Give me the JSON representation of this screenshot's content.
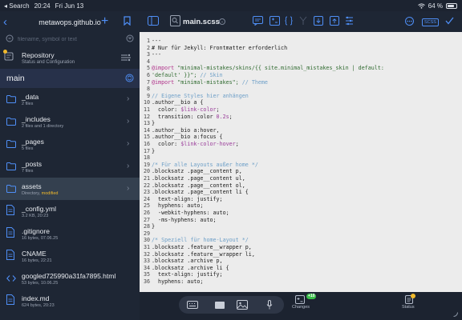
{
  "status_bar": {
    "back_app": "Search",
    "time": "20:24",
    "date": "Fri Jun 13",
    "battery": "64 %",
    "battery_level": 0.64
  },
  "sidebar": {
    "title": "metawops.github.io",
    "search_placeholder": "filename, symbol or text",
    "repository": {
      "name": "Repository",
      "subtitle": "Status and Configuration"
    },
    "branch": "main",
    "files": [
      {
        "name": "_data",
        "meta": "2 files",
        "type": "folder",
        "modified": "",
        "chevron": true
      },
      {
        "name": "_includes",
        "meta": "2 files and 1 directory",
        "type": "folder",
        "modified": "",
        "chevron": true
      },
      {
        "name": "_pages",
        "meta": "5 files",
        "type": "folder",
        "modified": "",
        "chevron": true
      },
      {
        "name": "_posts",
        "meta": "7 files",
        "type": "folder",
        "modified": "",
        "chevron": true
      },
      {
        "name": "assets",
        "meta": "Directory, ",
        "type": "folder",
        "modified": "modified",
        "chevron": true
      },
      {
        "name": "_config.yml",
        "meta": "3.2 KB, 20:23",
        "type": "file",
        "modified": "",
        "chevron": false
      },
      {
        "name": ".gitignore",
        "meta": "16 bytes, 07.06.25",
        "type": "file",
        "modified": "",
        "chevron": false
      },
      {
        "name": "CNAME",
        "meta": "16 bytes, 22:21",
        "type": "file",
        "modified": "",
        "chevron": false
      },
      {
        "name": "googled725990a31fa7895.html",
        "meta": "53 bytes, 10.06.25",
        "type": "code",
        "modified": "",
        "chevron": false
      },
      {
        "name": "index.md",
        "meta": "624 bytes, 20:23",
        "type": "file",
        "modified": "",
        "chevron": false
      }
    ]
  },
  "editor": {
    "filename": "main.scss",
    "language_badge": "SCSS",
    "lines": [
      [
        {
          "t": "---"
        }
      ],
      [
        {
          "t": "# Nur für Jekyll: Frontmatter erforderlich"
        }
      ],
      [
        {
          "t": "---"
        }
      ],
      [
        {
          "t": ""
        }
      ],
      [
        {
          "t": "@import",
          "c": "at"
        },
        {
          "t": " \"minimal-mistakes/skins/{{ site.minimal_mistakes_skin | default:",
          "c": "string"
        }
      ],
      [
        {
          "t": "'default' }}\";",
          "c": "string"
        },
        {
          "t": " // Skin",
          "c": "comment"
        }
      ],
      [
        {
          "t": "@import",
          "c": "at"
        },
        {
          "t": " \"minimal-mistakes\";",
          "c": "string"
        },
        {
          "t": " // Theme",
          "c": "comment"
        }
      ],
      [
        {
          "t": ""
        }
      ],
      [
        {
          "t": "// Eigene Styles hier anhängen",
          "c": "comment"
        }
      ],
      [
        {
          "t": ".author__bio a {"
        }
      ],
      [
        {
          "t": "  color: "
        },
        {
          "t": "$link-color",
          "c": "var"
        },
        {
          "t": ";"
        }
      ],
      [
        {
          "t": "  transition: color "
        },
        {
          "t": "0.2s",
          "c": "var"
        },
        {
          "t": ";"
        }
      ],
      [
        {
          "t": "}"
        }
      ],
      [
        {
          "t": ".author__bio a:hover,"
        }
      ],
      [
        {
          "t": ".author__bio a:focus {"
        }
      ],
      [
        {
          "t": "  color: "
        },
        {
          "t": "$link-color-hover",
          "c": "var"
        },
        {
          "t": ";"
        }
      ],
      [
        {
          "t": "}"
        }
      ],
      [
        {
          "t": ""
        }
      ],
      [
        {
          "t": "/* Für alle Layouts außer home */",
          "c": "comment"
        }
      ],
      [
        {
          "t": ".blocksatz .page__content p,"
        }
      ],
      [
        {
          "t": ".blocksatz .page__content ul,"
        }
      ],
      [
        {
          "t": ".blocksatz .page__content ol,"
        }
      ],
      [
        {
          "t": ".blocksatz .page__content li {"
        }
      ],
      [
        {
          "t": "  text-align: justify;"
        }
      ],
      [
        {
          "t": "  hyphens: auto;"
        }
      ],
      [
        {
          "t": "  -webkit-hyphens: auto;"
        }
      ],
      [
        {
          "t": "  -ms-hyphens: auto;"
        }
      ],
      [
        {
          "t": "}"
        }
      ],
      [
        {
          "t": ""
        }
      ],
      [
        {
          "t": "/* Speziell für home-Layout */",
          "c": "comment"
        }
      ],
      [
        {
          "t": ".blocksatz .feature__wrapper p,"
        }
      ],
      [
        {
          "t": ".blocksatz .feature__wrapper li,"
        }
      ],
      [
        {
          "t": ".blocksatz .archive p,"
        }
      ],
      [
        {
          "t": ".blocksatz .archive li {"
        }
      ],
      [
        {
          "t": "  text-align: justify;"
        }
      ],
      [
        {
          "t": "  hyphens: auto;"
        }
      ]
    ]
  },
  "bottom_bar": {
    "changes_label": "Changes",
    "changes_badge": "+10",
    "status_label": "Status"
  },
  "colors": {
    "accent": "#4f8ff7",
    "modified": "#f0b92b",
    "added": "#3bbf4a",
    "sidebar_bg": "#1e2634",
    "editor_bg": "#ececec"
  }
}
